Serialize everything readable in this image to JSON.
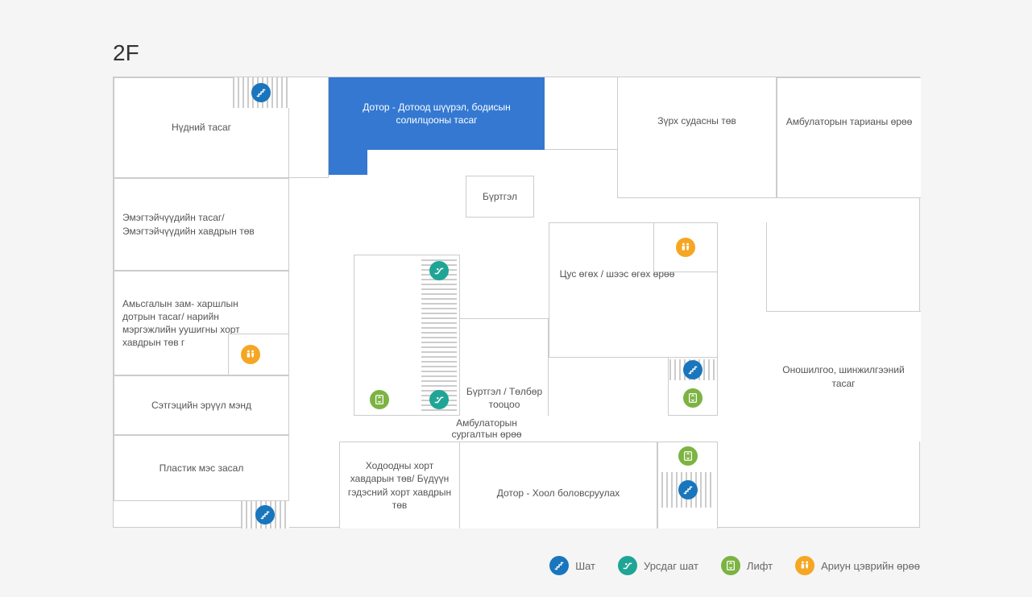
{
  "floor_label": "2F",
  "rooms": {
    "eye_dept": "Нүдний тасаг",
    "internal_endocrine": "Дотор - Дотоод шүүрэл, бодисын солилцооны тасаг",
    "cardio_center": "Зүрх судасны төв",
    "outpatient_injection": "Амбулаторын тарианы өрөө",
    "womens_dept": "Эмэгтэйчүүдийн тасаг/ Эмэгтэйчүүдийн хавдрын төв",
    "registration": "Бүртгэл",
    "respiratory": "Амьсгалын зам- харшлын дотрын тасаг/ нарийн мэргэжлийн уушигны хорт хавдрын төв г",
    "blood_urine": "Цус өгөх / шээс өгөх өрөө",
    "diagnostics": "Оношилгоо, шинжилгээний тасаг",
    "mental_health": "Сэтгэцийн эрүүл мэнд",
    "reg_payment": "Бүртгэл / Төлбөр тооцоо",
    "outpatient_training": "Амбулаторын сургалтын өрөө",
    "plastic_surgery": "Пластик мэс засал",
    "stomach_cancer": "Ходоодны хорт хавдарын төв/ Бүдүүн гэдэсний хорт хавдрын төв",
    "digestion": "Дотор - Хоол боловсруулах"
  },
  "legend": {
    "stairs": "Шат",
    "escalator": "Урсдаг шат",
    "elevator": "Лифт",
    "restroom": "Ариун цэврийн өрөө"
  },
  "icons": {
    "stairs": "stairs-icon",
    "escalator": "escalator-icon",
    "elevator": "elevator-icon",
    "restroom": "restroom-icon"
  }
}
